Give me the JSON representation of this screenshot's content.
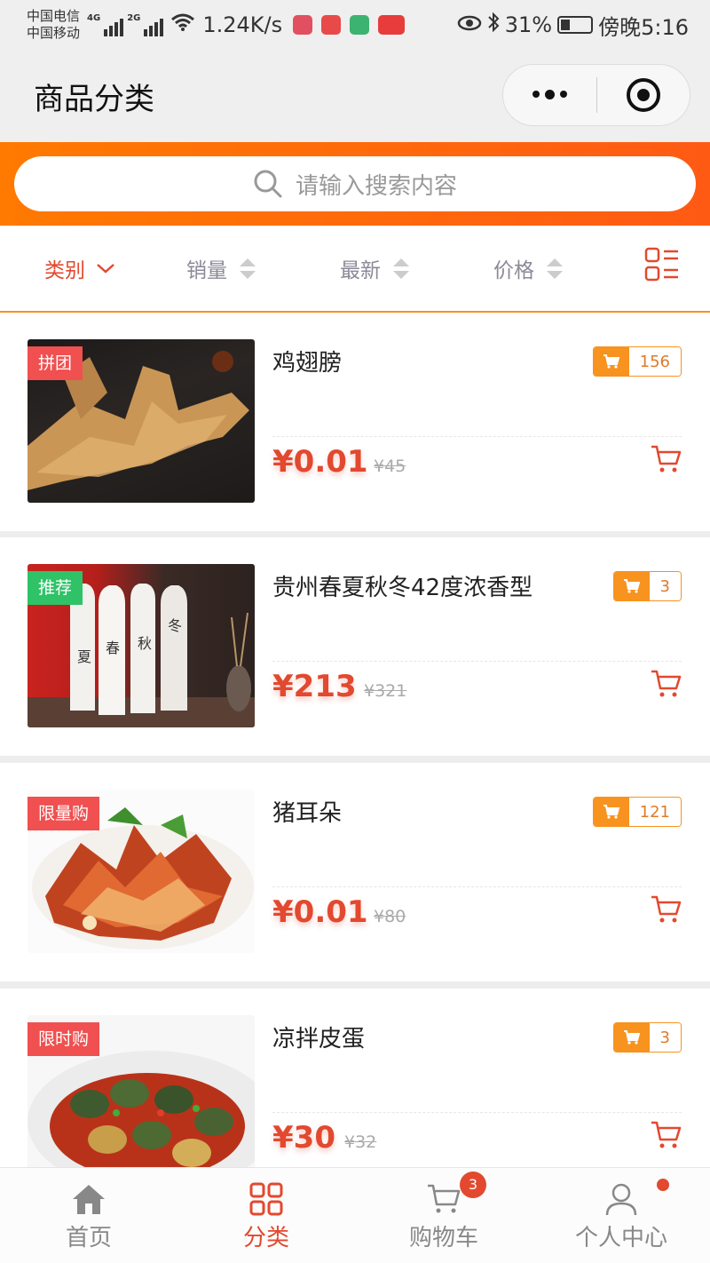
{
  "status_bar": {
    "carrier1": "中国电信",
    "carrier2": "中国移动",
    "net1": "4G",
    "net2": "2G",
    "speed": "1.24K/s",
    "battery": "31%",
    "time": "傍晚5:16"
  },
  "header": {
    "title": "商品分类"
  },
  "search": {
    "placeholder": "请输入搜索内容"
  },
  "filters": {
    "category": "类别",
    "sales": "销量",
    "newest": "最新",
    "price": "价格"
  },
  "products": [
    {
      "title": "鸡翅膀",
      "tag": "拼团",
      "sold": "156",
      "price": "¥0.01",
      "old_price": "¥45"
    },
    {
      "title": "贵州春夏秋冬42度浓香型",
      "tag": "推荐",
      "sold": "3",
      "price": "¥213",
      "old_price": "¥321"
    },
    {
      "title": "猪耳朵",
      "tag": "限量购",
      "sold": "121",
      "price": "¥0.01",
      "old_price": "¥80"
    },
    {
      "title": "凉拌皮蛋",
      "tag": "限时购",
      "sold": "3",
      "price": "¥30",
      "old_price": "¥32"
    }
  ],
  "tabbar": {
    "home": "首页",
    "category": "分类",
    "cart": "购物车",
    "cart_badge": "3",
    "profile": "个人中心"
  },
  "colors": {
    "accent": "#e2492f",
    "orange": "#f7931e"
  }
}
